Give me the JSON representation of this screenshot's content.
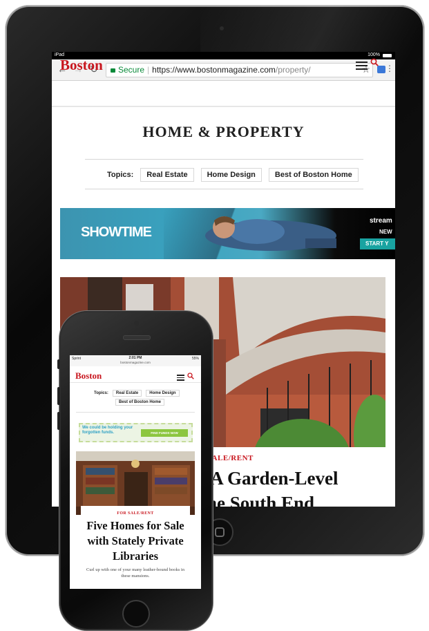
{
  "ipad": {
    "status": {
      "device": "iPad",
      "battery": "100%"
    },
    "browser": {
      "secure_label": "Secure",
      "url_host": "https://www.bostonmagazine.com",
      "url_path": "/property/"
    },
    "site": {
      "logo": "Boston",
      "section_title": "HOME & PROPERTY",
      "topics_label": "Topics:",
      "topics": [
        "Real Estate",
        "Home Design",
        "Best of Boston Home"
      ]
    },
    "ad": {
      "brand": "SHOWTIME",
      "line1": "stream",
      "line2": "NEW",
      "cta": "START Y"
    },
    "hero": {
      "kicker": "SALE/RENT",
      "headline_line1": ": A Garden-Level",
      "headline_line2": " the South End"
    }
  },
  "iphone": {
    "status": {
      "carrier": "Sprint",
      "time": "2:01 PM",
      "url": "bostonmagazine.com",
      "battery": "55%"
    },
    "site": {
      "logo": "Boston",
      "topics_label": "Topics:",
      "topics": [
        "Real Estate",
        "Home Design",
        "Best of Boston Home"
      ]
    },
    "ad": {
      "text": "We could be holding your forgotten funds.",
      "cta": "FIND FUNDS NOW"
    },
    "article": {
      "kicker": "FOR SALE/RENT",
      "headline": "Five Homes for Sale with Stately Private Libraries",
      "dek": "Curl up with one of your many leather-bound books in these mansions."
    }
  },
  "colors": {
    "brand_red": "#c8161e",
    "ad_teal": "#39a2bf",
    "ad_green": "#8cc63f"
  }
}
